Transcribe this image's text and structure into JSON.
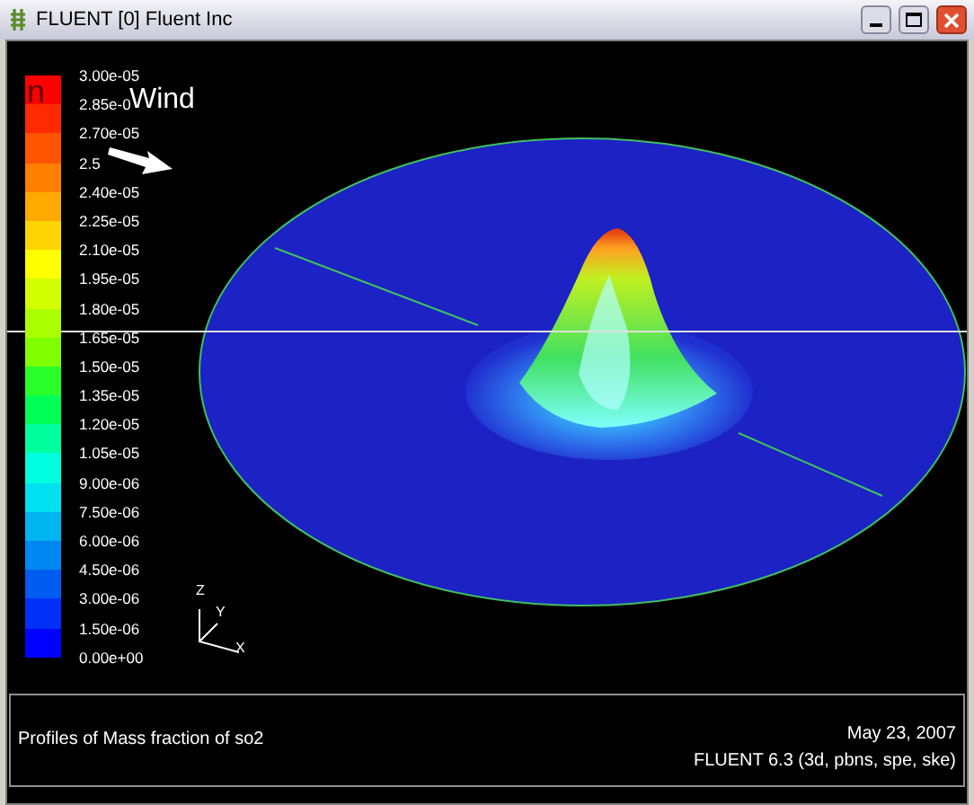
{
  "window": {
    "title": "FLUENT [0] Fluent Inc"
  },
  "legend": {
    "labels": [
      "3.00e-05",
      "2.85e-0",
      "2.70e-05",
      "2.5",
      "2.40e-05",
      "2.25e-05",
      "2.10e-05",
      "1.95e-05",
      "1.80e-05",
      "1.65e-05",
      "1.50e-05",
      "1.35e-05",
      "1.20e-05",
      "1.05e-05",
      "9.00e-06",
      "7.50e-06",
      "6.00e-06",
      "4.50e-06",
      "3.00e-06",
      "1.50e-06",
      "0.00e+00"
    ],
    "overlay_letter": "n"
  },
  "annotation": "Wind",
  "axes": [
    "Z",
    "Y",
    "X"
  ],
  "info": {
    "caption": "Profiles of Mass fraction of so2",
    "date": "May 23, 2007",
    "version": "FLUENT 6.3 (3d, pbns, spe, ske)"
  }
}
